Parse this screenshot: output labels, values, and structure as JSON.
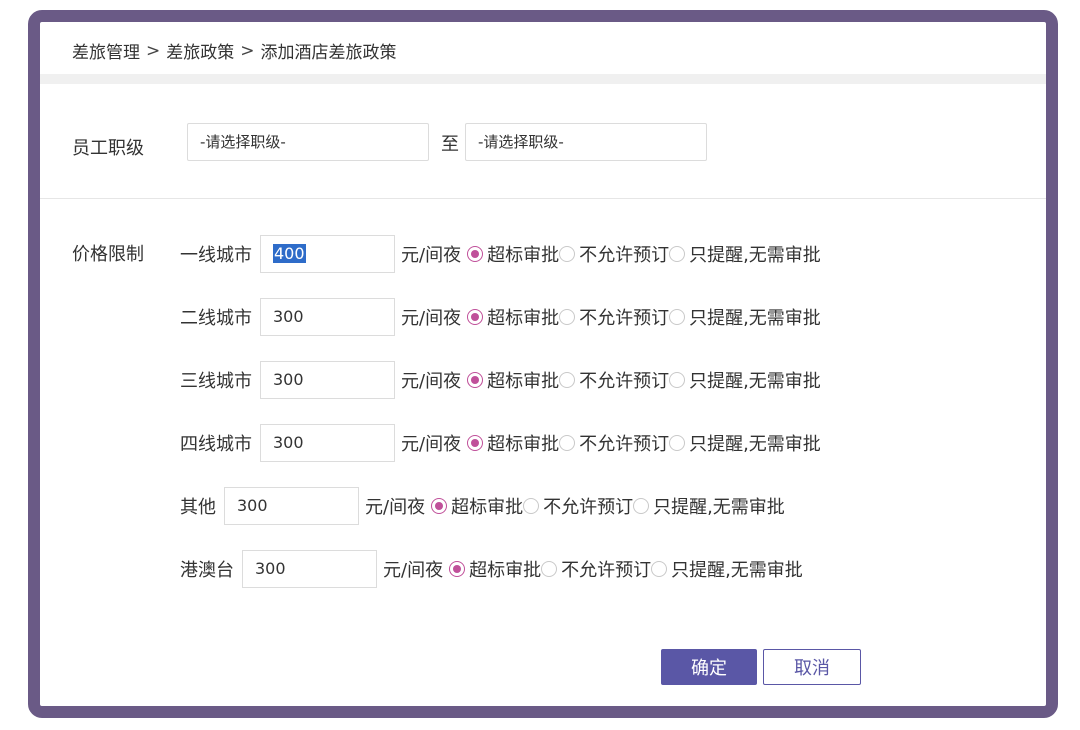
{
  "breadcrumb": {
    "items": [
      "差旅管理",
      "差旅政策",
      "添加酒店差旅政策"
    ],
    "separator": ">"
  },
  "level": {
    "label": "员工职级",
    "from_placeholder": "-请选择职级-",
    "to_text": "至",
    "to_placeholder": "-请选择职级-"
  },
  "price": {
    "label": "价格限制",
    "unit": "元/间夜",
    "rows": [
      {
        "city": "一线城市",
        "value": "400",
        "selected": 0
      },
      {
        "city": "二线城市",
        "value": "300",
        "selected": 0
      },
      {
        "city": "三线城市",
        "value": "300",
        "selected": 0
      },
      {
        "city": "四线城市",
        "value": "300",
        "selected": 0
      },
      {
        "city": "其他",
        "value": "300",
        "selected": 0
      },
      {
        "city": "港澳台",
        "value": "300",
        "selected": 0
      }
    ],
    "options": [
      "超标审批",
      "不允许预订",
      "只提醒,无需审批"
    ]
  },
  "buttons": {
    "confirm": "确定",
    "cancel": "取消"
  },
  "colors": {
    "frame": "#6a5a86",
    "primary": "#5a57a6",
    "radio_selected": "#c0509a"
  }
}
